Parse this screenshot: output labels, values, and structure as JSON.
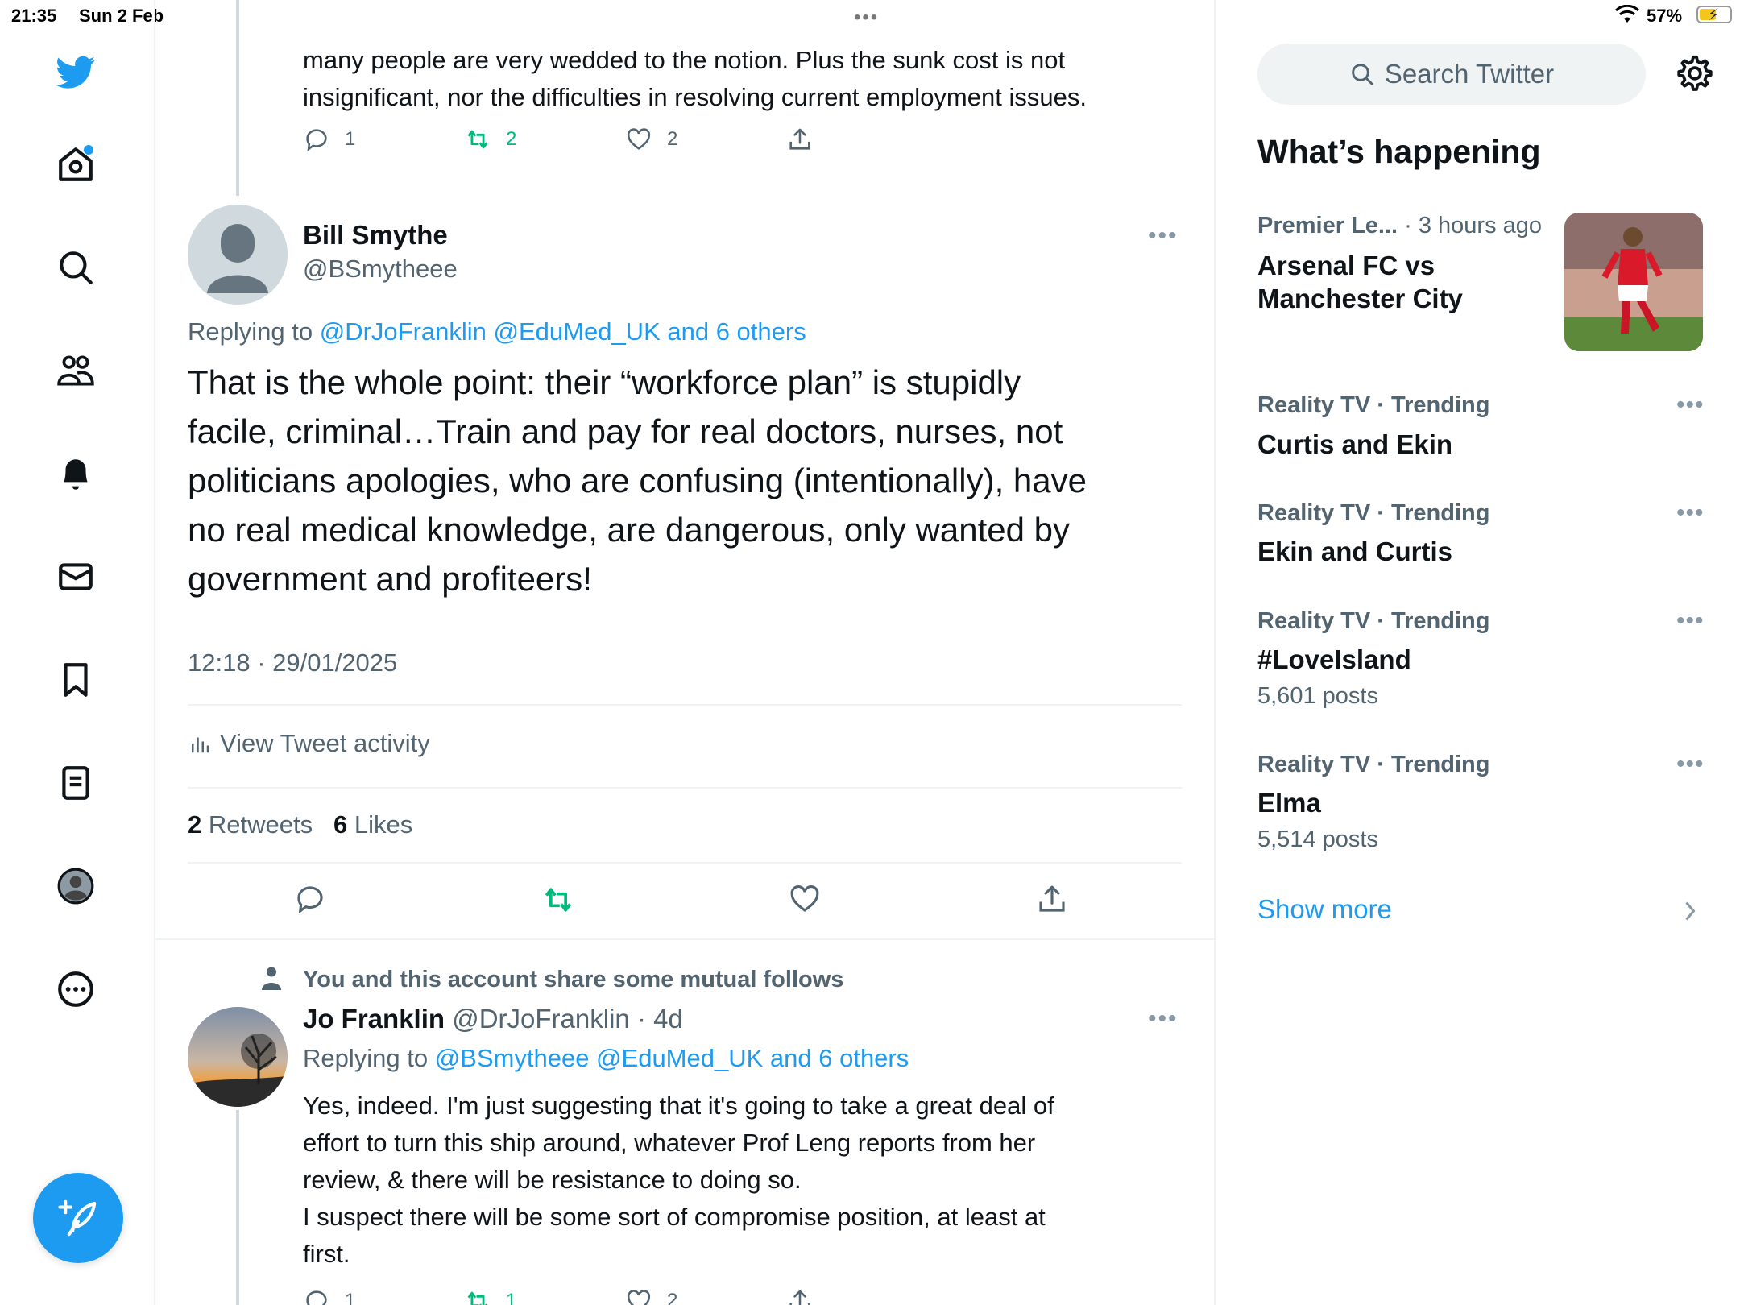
{
  "status_bar": {
    "time": "21:35",
    "date": "Sun 2 Feb",
    "battery": "57%"
  },
  "nav": {
    "items": [
      "twitter-logo",
      "home-icon",
      "search-icon",
      "communities-icon",
      "notifications-icon",
      "messages-icon",
      "bookmarks-icon",
      "lists-icon",
      "profile-avatar",
      "more-icon"
    ],
    "compose_icon": "compose-icon"
  },
  "prev_tweet": {
    "text_line1": "many people are very wedded to the notion. Plus the sunk cost is not",
    "text_line2": "insignificant, nor the difficulties in resolving current employment issues.",
    "replies": "1",
    "retweets": "2",
    "likes": "2"
  },
  "main_tweet": {
    "name": "Bill Smythe",
    "handle": "@BSmytheee",
    "replying_prefix": "Replying to",
    "replying_to": "@DrJoFranklin @EduMed_UK and 6 others",
    "text_lines": [
      "That is the whole point: their “workforce plan” is stupidly",
      "facile, criminal…Train and pay for real doctors, nurses, not",
      "politicians apologies, who are confusing (intentionally), have",
      "no real medical knowledge, are dangerous, only wanted by",
      "government and profiteers!"
    ],
    "timestamp": "12:18 · 29/01/2025",
    "activity_label": "View Tweet activity",
    "retweet_count": "2",
    "retweet_label": "Retweets",
    "like_count": "6",
    "like_label": "Likes"
  },
  "reply_tweet": {
    "social_context": "You and this account share some mutual follows",
    "name": "Jo Franklin",
    "handle": "@DrJoFranklin",
    "age": "· 4d",
    "replying_prefix": "Replying to",
    "replying_to": "@BSmytheee @EduMed_UK and 6 others",
    "text_lines": [
      "Yes, indeed. I'm just suggesting that it's going to take a great deal of",
      "effort to turn this ship around, whatever Prof Leng reports from her",
      "review, & there will be resistance to doing so.",
      "I suspect there will be some sort of compromise position, at least at",
      "first."
    ],
    "replies": "1",
    "retweets": "1",
    "likes": "2"
  },
  "sidebar": {
    "search_placeholder": "Search Twitter",
    "section_title": "What’s happening",
    "trends": [
      {
        "category": "Premier Le...",
        "meta": " · 3 hours ago",
        "title_line1": "Arsenal FC vs",
        "title_line2": "Manchester City",
        "count": ""
      },
      {
        "category": "Reality TV · Trending",
        "meta": "",
        "title_line1": "Curtis and Ekin",
        "title_line2": "",
        "count": ""
      },
      {
        "category": "Reality TV · Trending",
        "meta": "",
        "title_line1": "Ekin and Curtis",
        "title_line2": "",
        "count": ""
      },
      {
        "category": "Reality TV · Trending",
        "meta": "",
        "title_line1": "#LoveIsland",
        "title_line2": "",
        "count": "5,601 posts"
      },
      {
        "category": "Reality TV · Trending",
        "meta": "",
        "title_line1": "Elma",
        "title_line2": "",
        "count": "5,514 posts"
      }
    ],
    "show_more": "Show more"
  },
  "colors": {
    "accent": "#1d9bf0",
    "retweet_green": "#00ba7c",
    "secondary_text": "#536471"
  }
}
